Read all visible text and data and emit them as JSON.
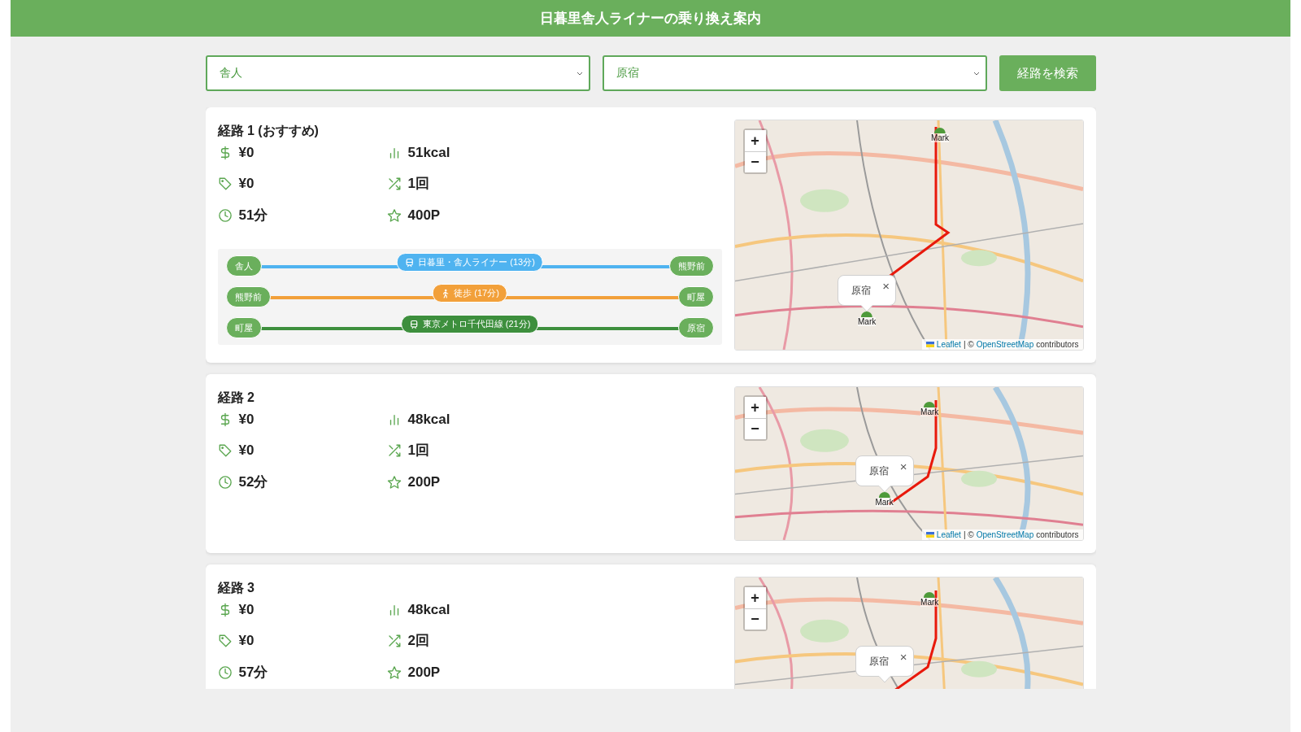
{
  "header": {
    "title": "日暮里舎人ライナーの乗り換え案内"
  },
  "search": {
    "from": "舎人",
    "to": "原宿",
    "button": "経路を検索"
  },
  "routes": [
    {
      "title": "経路 1 (おすすめ)",
      "stats": [
        {
          "kind": "fare",
          "text": "¥0"
        },
        {
          "kind": "calories",
          "text": "51kcal"
        },
        {
          "kind": "ic_fare",
          "text": "¥0"
        },
        {
          "kind": "transfers",
          "text": "1回"
        },
        {
          "kind": "time",
          "text": "51分"
        },
        {
          "kind": "points",
          "text": "400P"
        }
      ],
      "segments": [
        {
          "kind": "train",
          "from": "舎人",
          "to": "熊野前",
          "label": "日暮里・舎人ライナー (13分)",
          "color": "#4fb3f0"
        },
        {
          "kind": "walk",
          "from": "熊野前",
          "to": "町屋",
          "label": "徒歩 (17分)",
          "color": "#f2a03a"
        },
        {
          "kind": "train",
          "from": "町屋",
          "to": "原宿",
          "label": "東京メトロ千代田線 (21分)",
          "color": "#3d8f3d"
        }
      ],
      "map": {
        "kind": "picture",
        "zoom_in": "+",
        "zoom_out": "−",
        "popup": {
          "text": "原宿",
          "close": "×"
        },
        "markers": [
          "Mark",
          "Mark"
        ],
        "attribution": {
          "leaflet": "Leaflet",
          "separator": "| ©",
          "osm": "OpenStreetMap",
          "suffix": "contributors"
        }
      }
    },
    {
      "title": "経路 2",
      "stats": [
        {
          "kind": "fare",
          "text": "¥0"
        },
        {
          "kind": "calories",
          "text": "48kcal"
        },
        {
          "kind": "ic_fare",
          "text": "¥0"
        },
        {
          "kind": "transfers",
          "text": "1回"
        },
        {
          "kind": "time",
          "text": "52分"
        },
        {
          "kind": "points",
          "text": "200P"
        }
      ],
      "map": {
        "kind": "picture",
        "zoom_in": "+",
        "zoom_out": "−",
        "popup": {
          "text": "原宿",
          "close": "×"
        },
        "markers": [
          "Mark",
          "Mark"
        ],
        "attribution": {
          "leaflet": "Leaflet",
          "separator": "| ©",
          "osm": "OpenStreetMap",
          "suffix": "contributors"
        }
      }
    },
    {
      "title": "経路 3",
      "stats": [
        {
          "kind": "fare",
          "text": "¥0"
        },
        {
          "kind": "calories",
          "text": "48kcal"
        },
        {
          "kind": "ic_fare",
          "text": "¥0"
        },
        {
          "kind": "transfers",
          "text": "2回"
        },
        {
          "kind": "time",
          "text": "57分"
        },
        {
          "kind": "points",
          "text": "200P"
        }
      ],
      "map": {
        "kind": "picture",
        "zoom_in": "+",
        "zoom_out": "−",
        "popup": {
          "text": "原宿",
          "close": "×"
        },
        "markers": [
          "Mark"
        ]
      }
    }
  ]
}
